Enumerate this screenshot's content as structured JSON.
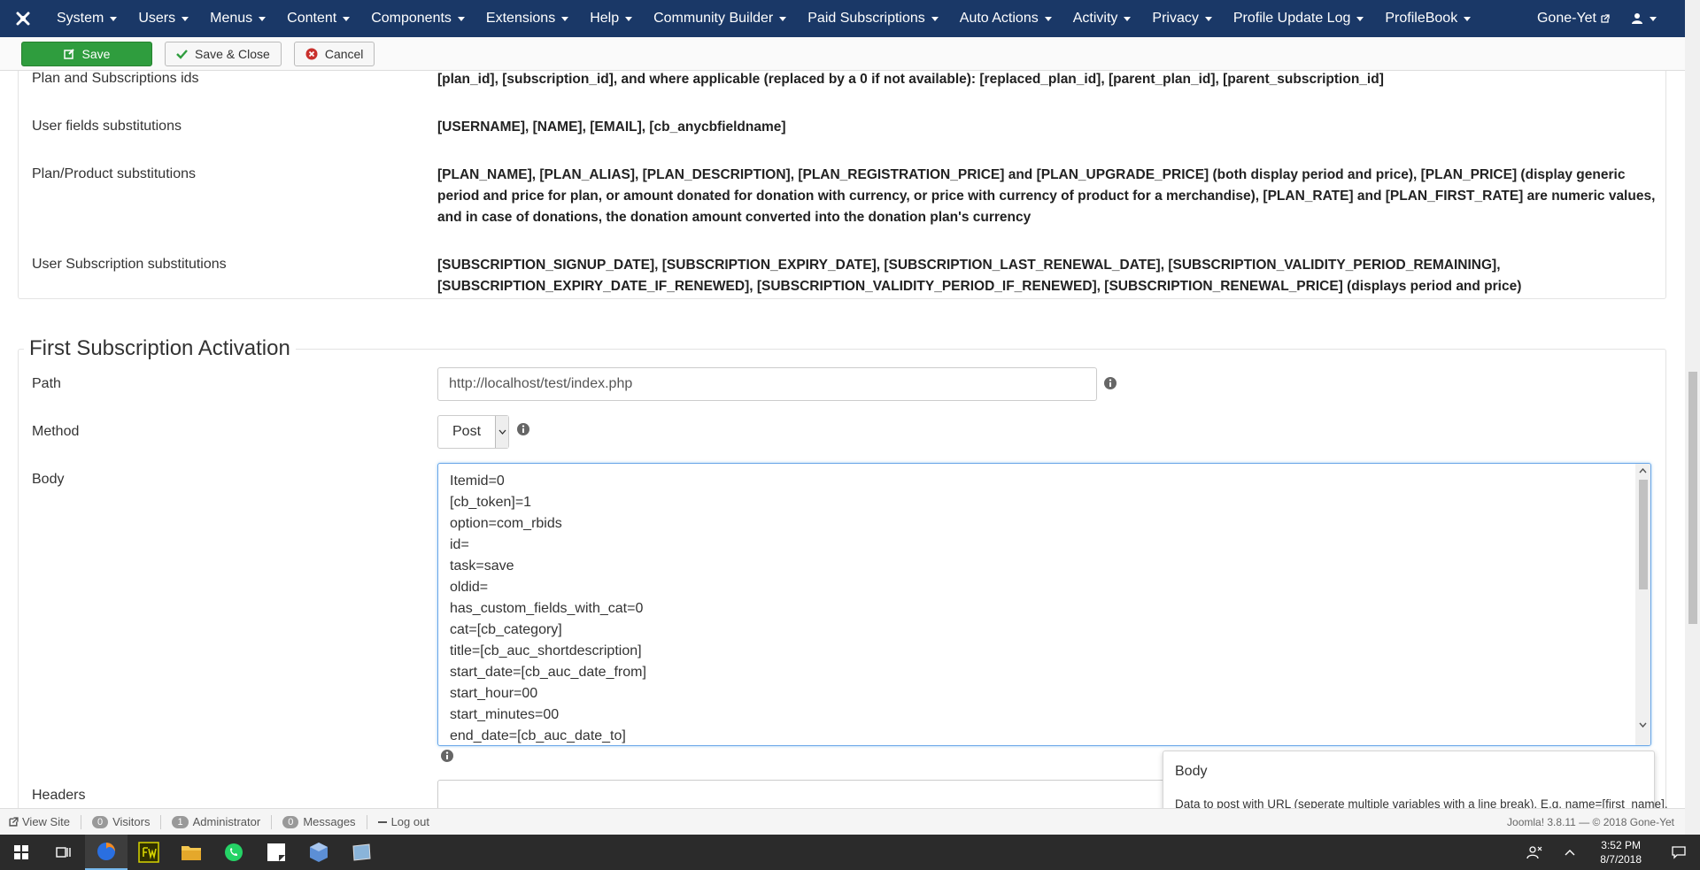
{
  "nav": {
    "items": [
      "System",
      "Users",
      "Menus",
      "Content",
      "Components",
      "Extensions",
      "Help",
      "Community Builder",
      "Paid Subscriptions",
      "Auto Actions",
      "Activity",
      "Privacy",
      "Profile Update Log",
      "ProfileBook"
    ],
    "site_link": "Gone-Yet"
  },
  "toolbar": {
    "save_label": "Save",
    "save_close_label": "Save & Close",
    "cancel_label": "Cancel"
  },
  "substitutions": {
    "rows": [
      {
        "label": "Plan and Subscriptions ids",
        "value": "[plan_id], [subscription_id], and where applicable (replaced by a 0 if not available): [replaced_plan_id], [parent_plan_id], [parent_subscription_id]"
      },
      {
        "label": "User fields substitutions",
        "value": "[USERNAME], [NAME], [EMAIL], [cb_anycbfieldname]"
      },
      {
        "label": "Plan/Product substitutions",
        "value": "[PLAN_NAME], [PLAN_ALIAS], [PLAN_DESCRIPTION], [PLAN_REGISTRATION_PRICE] and [PLAN_UPGRADE_PRICE] (both display period and price), [PLAN_PRICE] (display generic period and price for plan, or amount donated for donation with currency, or price with currency of product for a merchandise), [PLAN_RATE] and [PLAN_FIRST_RATE] are numeric values, and in case of donations, the donation amount converted into the donation plan's currency"
      },
      {
        "label": "User Subscription substitutions",
        "value": "[SUBSCRIPTION_SIGNUP_DATE], [SUBSCRIPTION_EXPIRY_DATE], [SUBSCRIPTION_LAST_RENEWAL_DATE], [SUBSCRIPTION_VALIDITY_PERIOD_REMAINING], [SUBSCRIPTION_EXPIRY_DATE_IF_RENEWED], [SUBSCRIPTION_VALIDITY_PERIOD_IF_RENEWED], [SUBSCRIPTION_RENEWAL_PRICE] (displays period and price)"
      }
    ]
  },
  "section": {
    "title": "First Subscription Activation",
    "path_label": "Path",
    "path_value": "http://localhost/test/index.php",
    "method_label": "Method",
    "method_value": "Post",
    "body_label": "Body",
    "body_lines": [
      "Itemid=0",
      "[cb_token]=1",
      "option=com_rbids",
      "id=",
      "task=save",
      "oldid=",
      "has_custom_fields_with_cat=0",
      "cat=[cb_category]",
      "title=[cb_auc_shortdescription]",
      "start_date=[cb_auc_date_from]",
      "start_hour=00",
      "start_minutes=00",
      "end_date=[cb_auc_date_to]"
    ],
    "headers_label": "Headers"
  },
  "tooltip": {
    "title": "Body",
    "text": "Data to post with URL (seperate multiple variables with a line break). E.g. name=[first_name]."
  },
  "status": {
    "view_site": "View Site",
    "visitors_count": "0",
    "visitors_label": "Visitors",
    "admin_count": "1",
    "admin_label": "Administrator",
    "messages_count": "0",
    "messages_label": "Messages",
    "logout": "Log out",
    "footer": "Joomla! 3.8.11 — © 2018 Gone-Yet"
  },
  "taskbar": {
    "time": "3:52 PM",
    "date": "8/7/2018"
  }
}
